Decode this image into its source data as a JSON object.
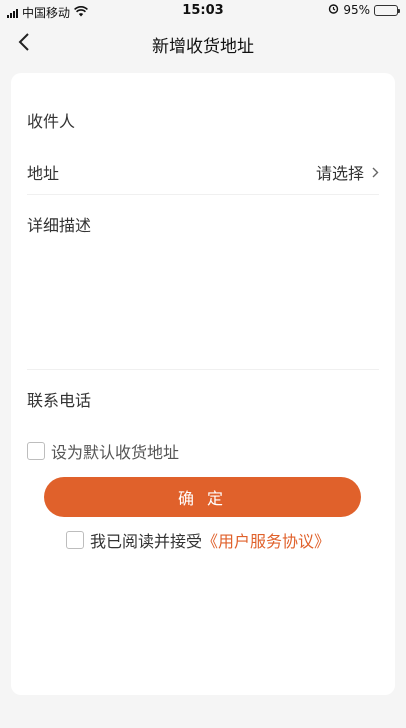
{
  "status": {
    "carrier": "中国移动",
    "time": "15:03",
    "battery": "95%",
    "battery_level": 0.95
  },
  "nav": {
    "title": "新增收货地址",
    "back_icon": "chevron-left-icon"
  },
  "form": {
    "recipient_label": "收件人",
    "address_label": "地址",
    "address_value": "请选择",
    "description_label": "详细描述",
    "phone_label": "联系电话"
  },
  "options": {
    "default_label": "设为默认收货地址",
    "default_checked": false
  },
  "actions": {
    "confirm_label": "确 定"
  },
  "agreement": {
    "prefix": "我已阅读并接受",
    "link": "《用户服务协议》",
    "checked": false
  },
  "colors": {
    "accent": "#e0612b",
    "background": "#f5f5f5",
    "card": "#ffffff"
  }
}
